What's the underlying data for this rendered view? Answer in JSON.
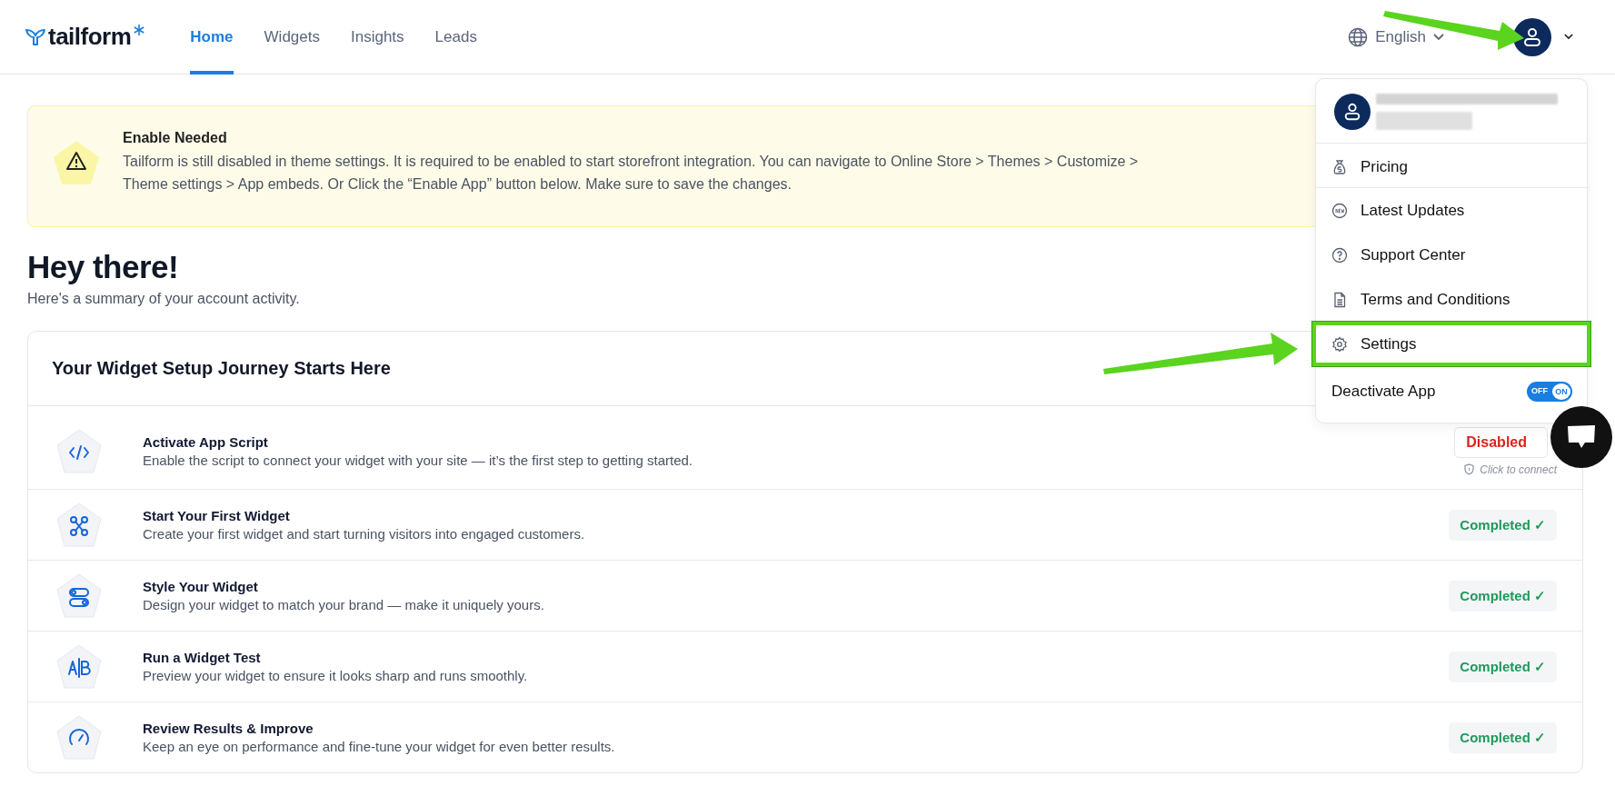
{
  "brand": {
    "name": "tailform"
  },
  "nav": [
    {
      "label": "Home",
      "selected": true
    },
    {
      "label": "Widgets",
      "selected": false
    },
    {
      "label": "Insights",
      "selected": false
    },
    {
      "label": "Leads",
      "selected": false
    }
  ],
  "language": {
    "label": "English"
  },
  "banner": {
    "title": "Enable Needed",
    "text": "Tailform is still disabled in theme settings. It is required to be enabled to start storefront integration. You can navigate to Online Store > Themes > Customize > Theme settings > App embeds. Or Click the “Enable App” button below. Make sure to save the changes."
  },
  "greeting": {
    "title": "Hey there!",
    "subtitle": "Here's a summary of your account activity."
  },
  "journey": {
    "title": "Your Widget Setup Journey Starts Here",
    "steps": [
      {
        "title": "Activate App Script",
        "text": "Enable the script to connect your widget with your site — it’s the first step to getting started.",
        "status": {
          "kind": "disabled",
          "label": "Disabled",
          "hint": "Click to connect"
        }
      },
      {
        "title": "Start Your First Widget",
        "text": "Create your first widget and start turning visitors into engaged customers.",
        "status": {
          "kind": "completed",
          "label": "Completed ✓"
        }
      },
      {
        "title": "Style Your Widget",
        "text": "Design your widget to match your brand — make it uniquely yours.",
        "status": {
          "kind": "completed",
          "label": "Completed ✓"
        }
      },
      {
        "title": "Run a Widget Test",
        "text": "Preview your widget to ensure it looks sharp and runs smoothly.",
        "status": {
          "kind": "completed",
          "label": "Completed ✓"
        }
      },
      {
        "title": "Review Results & Improve",
        "text": "Keep an eye on performance and fine-tune your widget for even better results.",
        "status": {
          "kind": "completed",
          "label": "Completed ✓"
        }
      }
    ]
  },
  "account_menu": {
    "items": [
      {
        "label": "Pricing",
        "highlighted": false
      },
      {
        "label": "Latest Updates",
        "highlighted": false
      },
      {
        "label": "Support Center",
        "highlighted": false
      },
      {
        "label": "Terms and Conditions",
        "highlighted": false
      },
      {
        "label": "Settings",
        "highlighted": true
      }
    ],
    "deactivate": {
      "label": "Deactivate App",
      "off_label": "OFF",
      "on_label": "ON",
      "on": true
    }
  }
}
